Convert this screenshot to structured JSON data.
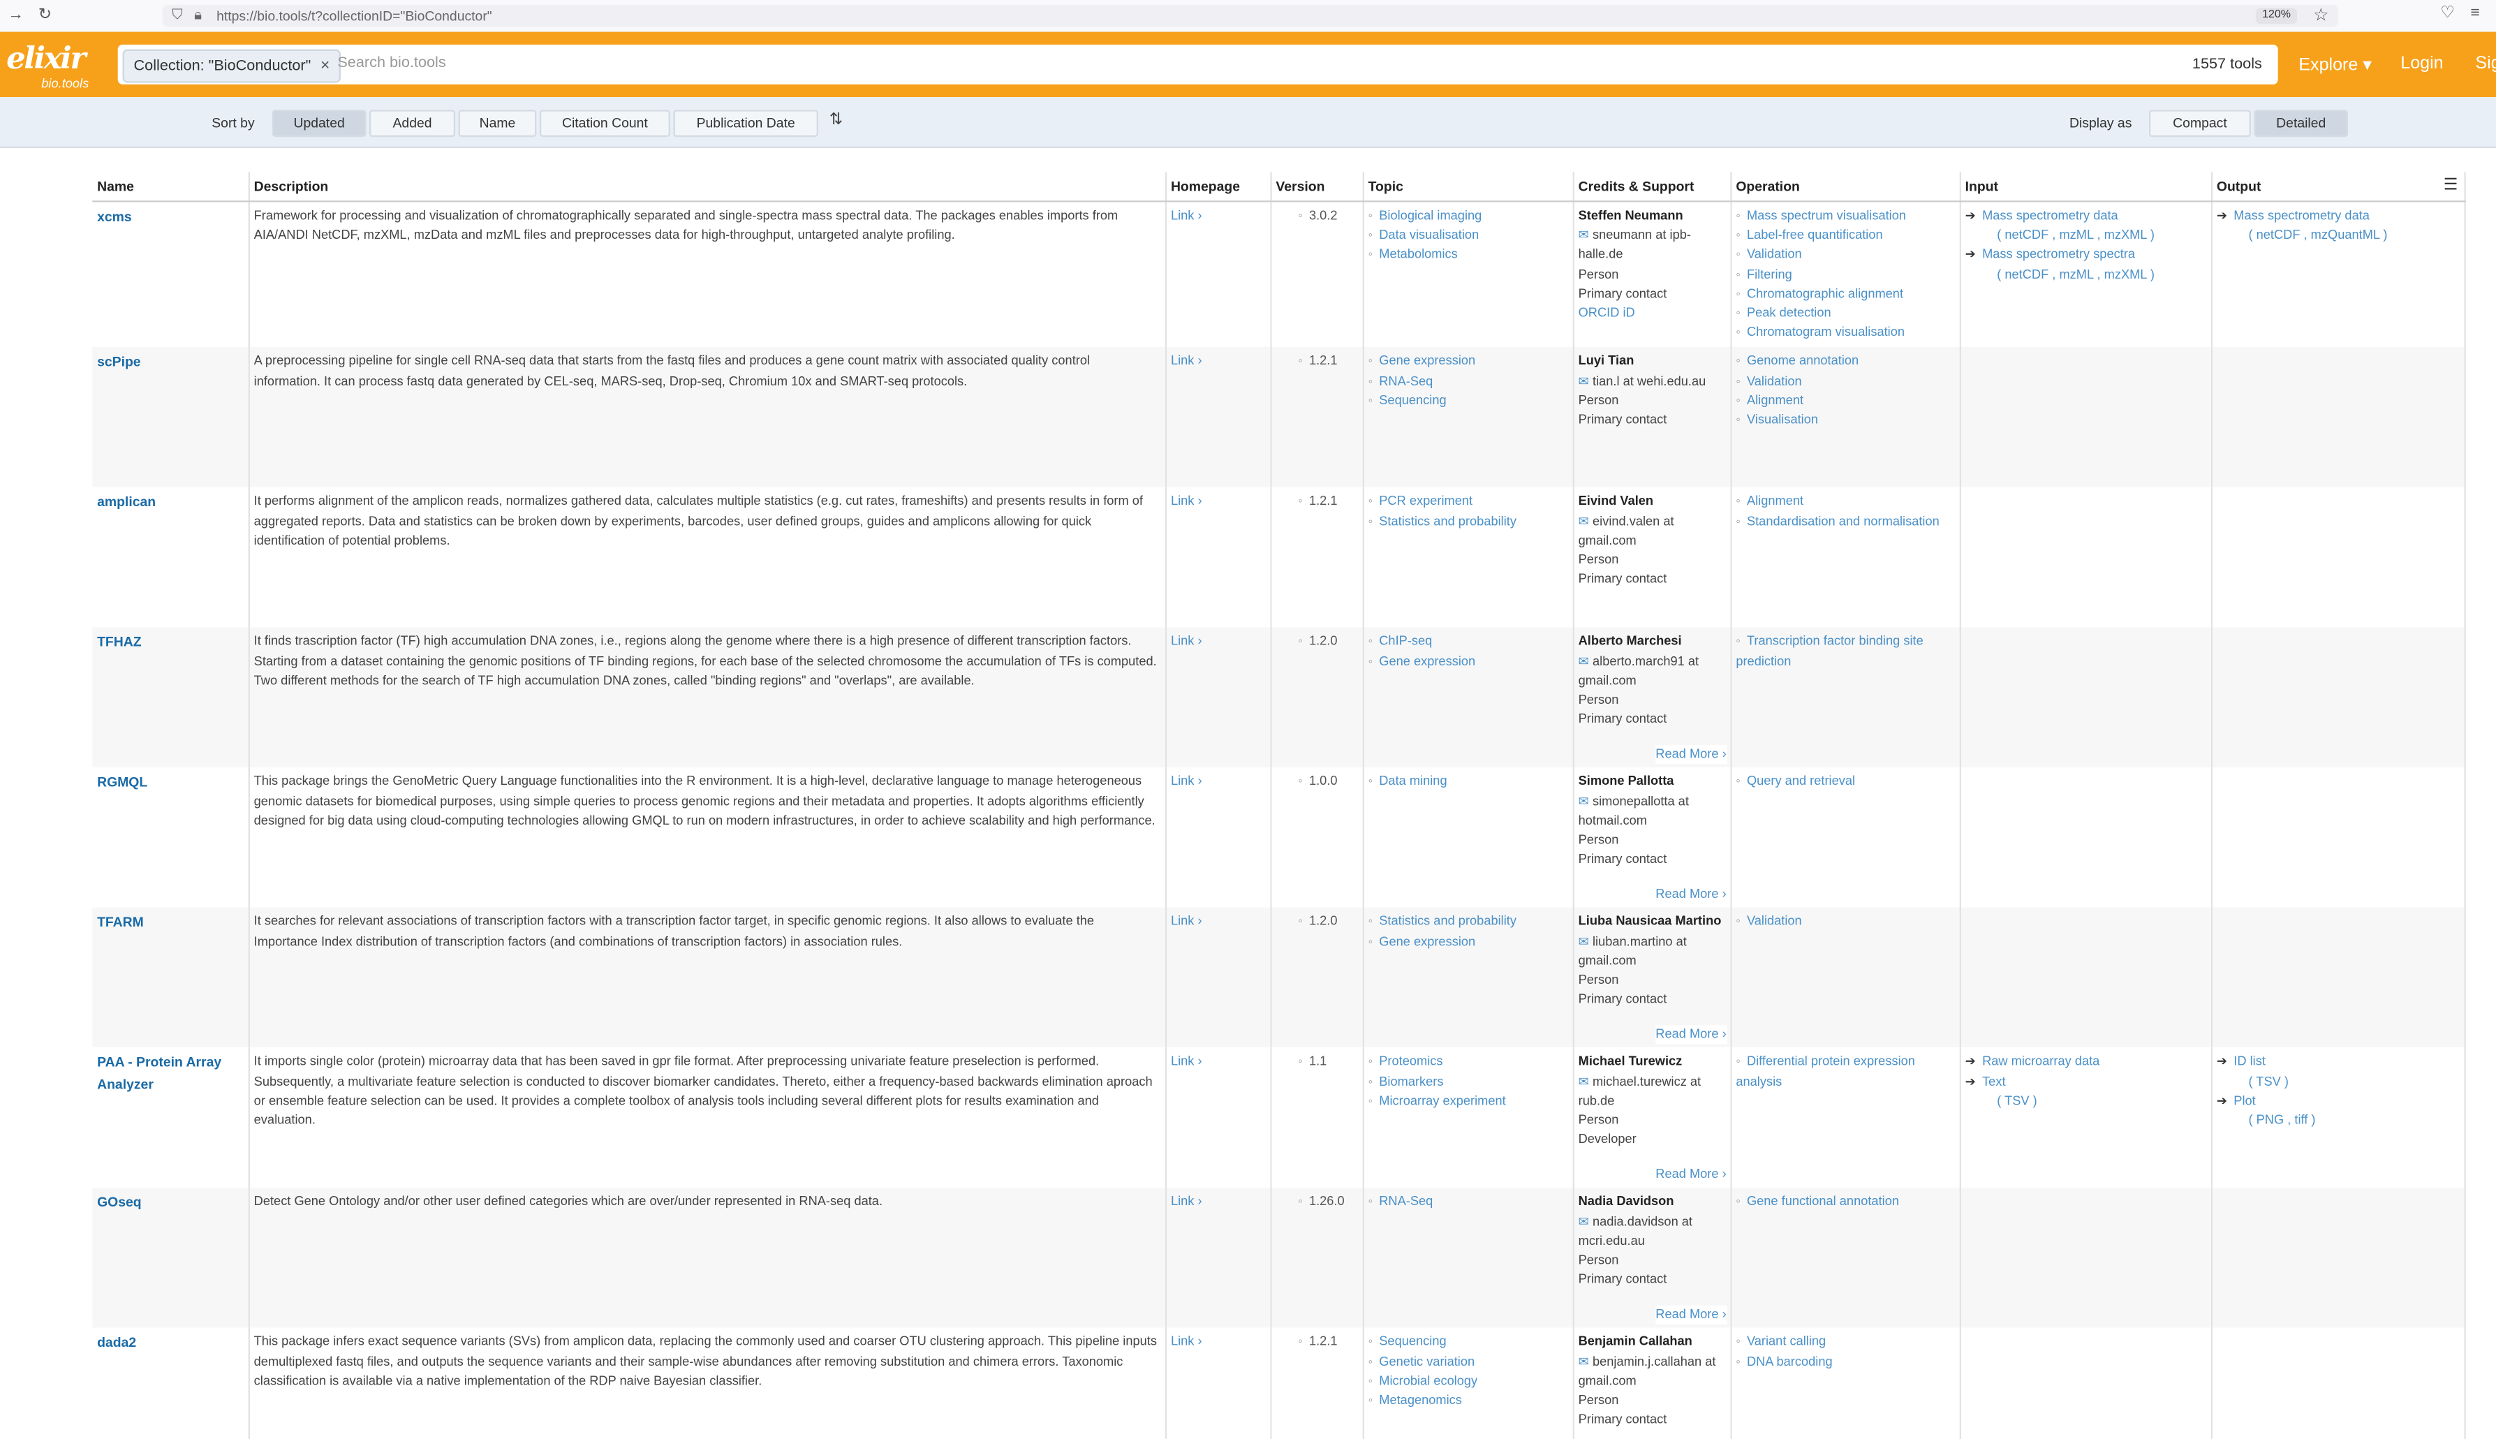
{
  "browser": {
    "url": "https://bio.tools/t?collectionID=\"BioConductor\"",
    "zoom": "120%"
  },
  "header": {
    "logo_text": "elixir",
    "logo_sub": "bio.tools",
    "chip_label": "Collection: \"BioConductor\"",
    "chip_close": "×",
    "search_placeholder": "Search bio.tools",
    "tool_count": "1557 tools",
    "nav": {
      "explore": "Explore ▾",
      "login": "Login",
      "signup": "Sig"
    }
  },
  "sortbar": {
    "sort_label": "Sort by",
    "sort_options": [
      "Updated",
      "Added",
      "Name",
      "Citation Count",
      "Publication Date"
    ],
    "active_sort": "Updated",
    "display_label": "Display as",
    "display_options": [
      "Compact",
      "Detailed"
    ],
    "active_display": "Detailed"
  },
  "table": {
    "columns": [
      "Name",
      "Description",
      "Homepage",
      "Version",
      "Topic",
      "Credits & Support",
      "Operation",
      "Input",
      "Output"
    ],
    "read_more": "Read More ›",
    "rows": [
      {
        "name": "xcms",
        "description": "Framework for processing and visualization of chromatographically separated and single-spectra mass spectral data. The packages enables imports from AIA/ANDI NetCDF, mzXML, mzData and mzML files and preprocesses data for high-throughput, untargeted analyte profiling.",
        "homepage": "Link ›",
        "version": "3.0.2",
        "topics": [
          "Biological imaging",
          "Data visualisation",
          "Metabolomics"
        ],
        "credit": {
          "name": "Steffen Neumann",
          "email": "sneumann at ipb-halle.de",
          "type": "Person",
          "role": "Primary contact",
          "extra": "ORCID iD"
        },
        "operations": [
          "Mass spectrum visualisation",
          "Label-free quantification",
          "Validation",
          "Filtering",
          "Chromatographic alignment",
          "Peak detection",
          "Chromatogram visualisation"
        ],
        "inputs": [
          {
            "label": "Mass spectrometry data",
            "formats": "( netCDF , mzML , mzXML )"
          },
          {
            "label": "Mass spectrometry spectra",
            "formats": "( netCDF , mzML , mzXML )"
          }
        ],
        "outputs": [
          {
            "label": "Mass spectrometry data",
            "formats": "( netCDF , mzQuantML )"
          }
        ],
        "read_more": false
      },
      {
        "name": "scPipe",
        "description": "A preprocessing pipeline for single cell RNA-seq data that starts from the fastq files and produces a gene count matrix with associated quality control information. It can process fastq data generated by CEL-seq, MARS-seq, Drop-seq, Chromium 10x and SMART-seq protocols.",
        "homepage": "Link ›",
        "version": "1.2.1",
        "topics": [
          "Gene expression",
          "RNA-Seq",
          "Sequencing"
        ],
        "credit": {
          "name": "Luyi Tian",
          "email": "tian.l at wehi.edu.au",
          "type": "Person",
          "role": "Primary contact",
          "extra": ""
        },
        "operations": [
          "Genome annotation",
          "Validation",
          "Alignment",
          "Visualisation"
        ],
        "inputs": [],
        "outputs": [],
        "read_more": false
      },
      {
        "name": "amplican",
        "description": "It performs alignment of the amplicon reads, normalizes gathered data, calculates multiple statistics (e.g. cut rates, frameshifts) and presents results in form of aggregated reports. Data and statistics can be broken down by experiments, barcodes, user defined groups, guides and amplicons allowing for quick identification of potential problems.",
        "homepage": "Link ›",
        "version": "1.2.1",
        "topics": [
          "PCR experiment",
          "Statistics and probability"
        ],
        "credit": {
          "name": "Eivind Valen",
          "email": "eivind.valen at gmail.com",
          "type": "Person",
          "role": "Primary contact",
          "extra": ""
        },
        "operations": [
          "Alignment",
          "Standardisation and normalisation"
        ],
        "inputs": [],
        "outputs": [],
        "read_more": false
      },
      {
        "name": "TFHAZ",
        "description": "It finds trascription factor (TF) high accumulation DNA zones, i.e., regions along the genome where there is a high presence of different transcription factors. Starting from a dataset containing the genomic positions of TF binding regions, for each base of the selected chromosome the accumulation of TFs is computed. Two different methods for the search of TF high accumulation DNA zones, called \"binding regions\" and \"overlaps\", are available.",
        "homepage": "Link ›",
        "version": "1.2.0",
        "topics": [
          "ChIP-seq",
          "Gene expression"
        ],
        "credit": {
          "name": "Alberto Marchesi",
          "email": "alberto.march91 at gmail.com",
          "type": "Person",
          "role": "Primary contact",
          "extra": ""
        },
        "operations": [
          "Transcription factor binding site prediction"
        ],
        "inputs": [],
        "outputs": [],
        "read_more": true
      },
      {
        "name": "RGMQL",
        "description": "This package brings the GenoMetric Query Language functionalities into the R environment. It is a high-level, declarative language to manage heterogeneous genomic datasets for biomedical purposes, using simple queries to process genomic regions and their metadata and properties. It adopts algorithms efficiently designed for big data using cloud-computing technologies allowing GMQL to run on modern infrastructures, in order to achieve scalability and high performance.",
        "homepage": "Link ›",
        "version": "1.0.0",
        "topics": [
          "Data mining"
        ],
        "credit": {
          "name": "Simone Pallotta",
          "email": "simonepallotta at hotmail.com",
          "type": "Person",
          "role": "Primary contact",
          "extra": ""
        },
        "operations": [
          "Query and retrieval"
        ],
        "inputs": [],
        "outputs": [],
        "read_more": true
      },
      {
        "name": "TFARM",
        "description": "It searches for relevant associations of transcription factors with a transcription factor target, in specific genomic regions. It also allows to evaluate the Importance Index distribution of transcription factors (and combinations of transcription factors) in association rules.",
        "homepage": "Link ›",
        "version": "1.2.0",
        "topics": [
          "Statistics and probability",
          "Gene expression"
        ],
        "credit": {
          "name": "Liuba Nausicaa Martino",
          "email": "liuban.martino at gmail.com",
          "type": "Person",
          "role": "Primary contact",
          "extra": ""
        },
        "operations": [
          "Validation"
        ],
        "inputs": [],
        "outputs": [],
        "read_more": true
      },
      {
        "name": "PAA - Protein Array Analyzer",
        "description": "It imports single color (protein) microarray data that has been saved in gpr file format. After preprocessing univariate feature preselection is performed. Subsequently, a multivariate feature selection is conducted to discover biomarker candidates. Thereto, either a frequency-based backwards elimination aproach or ensemble feature selection can be used. It provides a complete toolbox of analysis tools including several different plots for results examination and evaluation.",
        "homepage": "Link ›",
        "version": "1.1",
        "topics": [
          "Proteomics",
          "Biomarkers",
          "Microarray experiment"
        ],
        "credit": {
          "name": "Michael Turewicz",
          "email": "michael.turewicz at rub.de",
          "type": "Person",
          "role": "Developer",
          "extra": ""
        },
        "operations": [
          "Differential protein expression analysis"
        ],
        "inputs": [
          {
            "label": "Raw microarray data",
            "formats": ""
          },
          {
            "label": "Text",
            "formats": "( TSV )"
          }
        ],
        "outputs": [
          {
            "label": "ID list",
            "formats": "( TSV )"
          },
          {
            "label": "Plot",
            "formats": "( PNG , tiff )"
          }
        ],
        "read_more": true
      },
      {
        "name": "GOseq",
        "description": "Detect Gene Ontology and/or other user defined categories which are over/under represented in RNA-seq data.",
        "homepage": "Link ›",
        "version": "1.26.0",
        "topics": [
          "RNA-Seq"
        ],
        "credit": {
          "name": "Nadia Davidson",
          "email": "nadia.davidson at mcri.edu.au",
          "type": "Person",
          "role": "Primary contact",
          "extra": ""
        },
        "operations": [
          "Gene functional annotation"
        ],
        "inputs": [],
        "outputs": [],
        "read_more": true
      },
      {
        "name": "dada2",
        "description": "This package infers exact sequence variants (SVs) from amplicon data, replacing the commonly used and coarser OTU clustering approach. This pipeline inputs demultiplexed fastq files, and outputs the sequence variants and their sample-wise abundances after removing substitution and chimera errors. Taxonomic classification is available via a native implementation of the RDP naive Bayesian classifier.",
        "homepage": "Link ›",
        "version": "1.2.1",
        "topics": [
          "Sequencing",
          "Genetic variation",
          "Microbial ecology",
          "Metagenomics"
        ],
        "credit": {
          "name": "Benjamin Callahan",
          "email": "benjamin.j.callahan at gmail.com",
          "type": "Person",
          "role": "Primary contact",
          "extra": ""
        },
        "operations": [
          "Variant calling",
          "DNA barcoding"
        ],
        "inputs": [],
        "outputs": [],
        "read_more": false
      }
    ]
  }
}
